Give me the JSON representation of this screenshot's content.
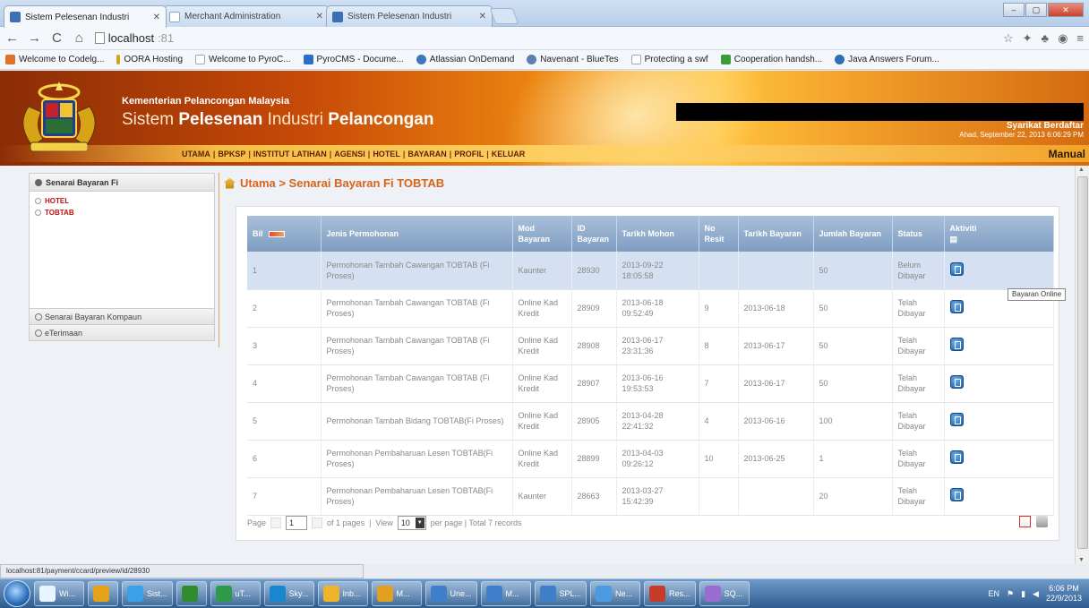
{
  "browser": {
    "tabs": [
      {
        "title": "Sistem Pelesenan Industri",
        "active": true
      },
      {
        "title": "Merchant Administration",
        "active": false
      },
      {
        "title": "Sistem Pelesenan Industri",
        "active": false
      }
    ],
    "address": {
      "host": "localhost",
      "port": ":81"
    },
    "bookmarks": [
      {
        "label": "Welcome to Codelg...",
        "icon": "codeigniter-icon"
      },
      {
        "label": "OORA Hosting",
        "icon": "hosting-icon"
      },
      {
        "label": "Welcome to PyroC...",
        "icon": "page-icon"
      },
      {
        "label": "PyroCMS - Docume...",
        "icon": "pyrocms-icon"
      },
      {
        "label": "Atlassian OnDemand",
        "icon": "atlassian-icon"
      },
      {
        "label": "Navenant - BlueTes",
        "icon": "navenant-icon"
      },
      {
        "label": "Protecting a swf",
        "icon": "page-icon"
      },
      {
        "label": "Cooperation handsh...",
        "icon": "cooperation-icon"
      },
      {
        "label": "Java Answers Forum...",
        "icon": "java-icon"
      }
    ]
  },
  "header": {
    "ministry": "Kementerian Pelancongan Malaysia",
    "system_prefix": "Sistem",
    "system_bold": "Pelesenan",
    "system_mid": "Industri",
    "system_end": "Pelancongan",
    "company_label": "Syarikat Berdaftar",
    "login_date": "Ahad, September 22, 2013 6:06:29 PM",
    "manual": "Manual",
    "nav": [
      "UTAMA",
      "BPKSP",
      "INSTITUT LATIHAN",
      "AGENSI",
      "HOTEL",
      "BAYARAN",
      "PROFIL",
      "KELUAR"
    ]
  },
  "sidebar": {
    "section_title": "Senarai Bayaran Fi",
    "items": [
      "HOTEL",
      "TOBTAB"
    ],
    "collapsed": [
      "Senarai Bayaran Kompaun",
      "eTerimaan"
    ]
  },
  "breadcrumb": "Utama > Senarai Bayaran Fi TOBTAB",
  "table": {
    "headers": {
      "bil": "Bil",
      "jenis": "Jenis Permohonan",
      "mod": "Mod Bayaran",
      "id": "ID Bayaran",
      "tarikh_mohon": "Tarikh Mohon",
      "resit": "No Resit",
      "tarikh_bayaran": "Tarikh Bayaran",
      "jumlah": "Jumlah Bayaran",
      "status": "Status",
      "aktiviti": "Aktiviti"
    },
    "rows": [
      {
        "bil": "1",
        "jenis": "Permohonan Tambah Cawangan TOBTAB (Fi Proses)",
        "mod": "Kaunter",
        "id": "28930",
        "tarikh_mohon": "2013-09-22 18:05:58",
        "resit": "",
        "tarikh_bayaran": "",
        "jumlah": "50",
        "status": "Belum Dibayar"
      },
      {
        "bil": "2",
        "jenis": "Permohonan Tambah Cawangan TOBTAB (Fi Proses)",
        "mod": "Online Kad Kredit",
        "id": "28909",
        "tarikh_mohon": "2013-06-18 09:52:49",
        "resit": "9",
        "tarikh_bayaran": "2013-06-18",
        "jumlah": "50",
        "status": "Telah Dibayar"
      },
      {
        "bil": "3",
        "jenis": "Permohonan Tambah Cawangan TOBTAB (Fi Proses)",
        "mod": "Online Kad Kredit",
        "id": "28908",
        "tarikh_mohon": "2013-06-17 23:31:36",
        "resit": "8",
        "tarikh_bayaran": "2013-06-17",
        "jumlah": "50",
        "status": "Telah Dibayar"
      },
      {
        "bil": "4",
        "jenis": "Permohonan Tambah Cawangan TOBTAB (Fi Proses)",
        "mod": "Online Kad Kredit",
        "id": "28907",
        "tarikh_mohon": "2013-06-16 19:53:53",
        "resit": "7",
        "tarikh_bayaran": "2013-06-17",
        "jumlah": "50",
        "status": "Telah Dibayar"
      },
      {
        "bil": "5",
        "jenis": "Permohonan Tambah Bidang TOBTAB(Fi Proses)",
        "mod": "Online Kad Kredit",
        "id": "28905",
        "tarikh_mohon": "2013-04-28 22:41:32",
        "resit": "4",
        "tarikh_bayaran": "2013-06-16",
        "jumlah": "100",
        "status": "Telah Dibayar"
      },
      {
        "bil": "6",
        "jenis": "Permohonan Pembaharuan Lesen TOBTAB(Fi Proses)",
        "mod": "Online Kad Kredit",
        "id": "28899",
        "tarikh_mohon": "2013-04-03 09:26:12",
        "resit": "10",
        "tarikh_bayaran": "2013-06-25",
        "jumlah": "1",
        "status": "Telah Dibayar"
      },
      {
        "bil": "7",
        "jenis": "Permohonan Pembaharuan Lesen TOBTAB(Fi Proses)",
        "mod": "Kaunter",
        "id": "28663",
        "tarikh_mohon": "2013-03-27 15:42:39",
        "resit": "",
        "tarikh_bayaran": "",
        "jumlah": "20",
        "status": "Telah Dibayar"
      }
    ],
    "tooltip": "Bayaran Online"
  },
  "pager": {
    "page_label": "Page",
    "page_value": "1",
    "of_label": "of 1 pages",
    "view_label": "View",
    "view_value": "10",
    "per_page_label": "per page | Total 7 records"
  },
  "status_url": "localhost:81/payment/ccard/preview/id/28930",
  "taskbar": {
    "apps": [
      "Wi...",
      "",
      "Sist...",
      "",
      "uT...",
      "Sky...",
      "Inb...",
      "M...",
      "Une...",
      "M...",
      "SPL...",
      "Ne...",
      "Res...",
      "SQ..."
    ],
    "lang": "EN",
    "time": "6:06 PM",
    "date": "22/9/2013"
  },
  "colors": {
    "header_orange": "#f08c12",
    "breadcrumb": "#d8641a",
    "table_header": "#8fa9cc",
    "highlight_row": "#d6e0f3",
    "sidebar_link": "#c01010"
  }
}
